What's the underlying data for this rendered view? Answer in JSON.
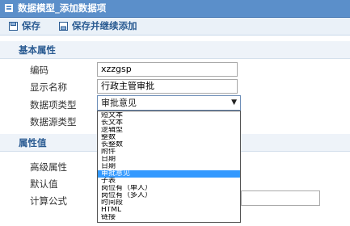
{
  "window": {
    "title": "数据模型_添加数据项"
  },
  "toolbar": {
    "save_label": "保存",
    "save_continue_label": "保存并继续添加"
  },
  "sections": {
    "basic": "基本属性",
    "value": "属性值"
  },
  "fields": {
    "code_label": "编码",
    "code_value": "xzzgsp",
    "display_label": "显示名称",
    "display_value": "行政主管审批",
    "datatype_label": "数据项类型",
    "datatype_value": "审批意见",
    "source_label": "数据源类型",
    "advanced_label": "高级属性",
    "default_label": "默认值",
    "formula_label": "计算公式"
  },
  "dropdown": {
    "options": [
      "短文本",
      "长文本",
      "逻辑型",
      "整数",
      "长整数",
      "附件",
      "日期",
      "日期",
      "审批意见",
      "子表",
      "岗位有（单人）",
      "岗位有（多人）",
      "时间段",
      "HTML",
      "链接"
    ],
    "selected_index": 8
  },
  "colors": {
    "title_bar": "#5b8fca",
    "selected_option": "#3399ff",
    "section_text": "#2a5b92"
  }
}
